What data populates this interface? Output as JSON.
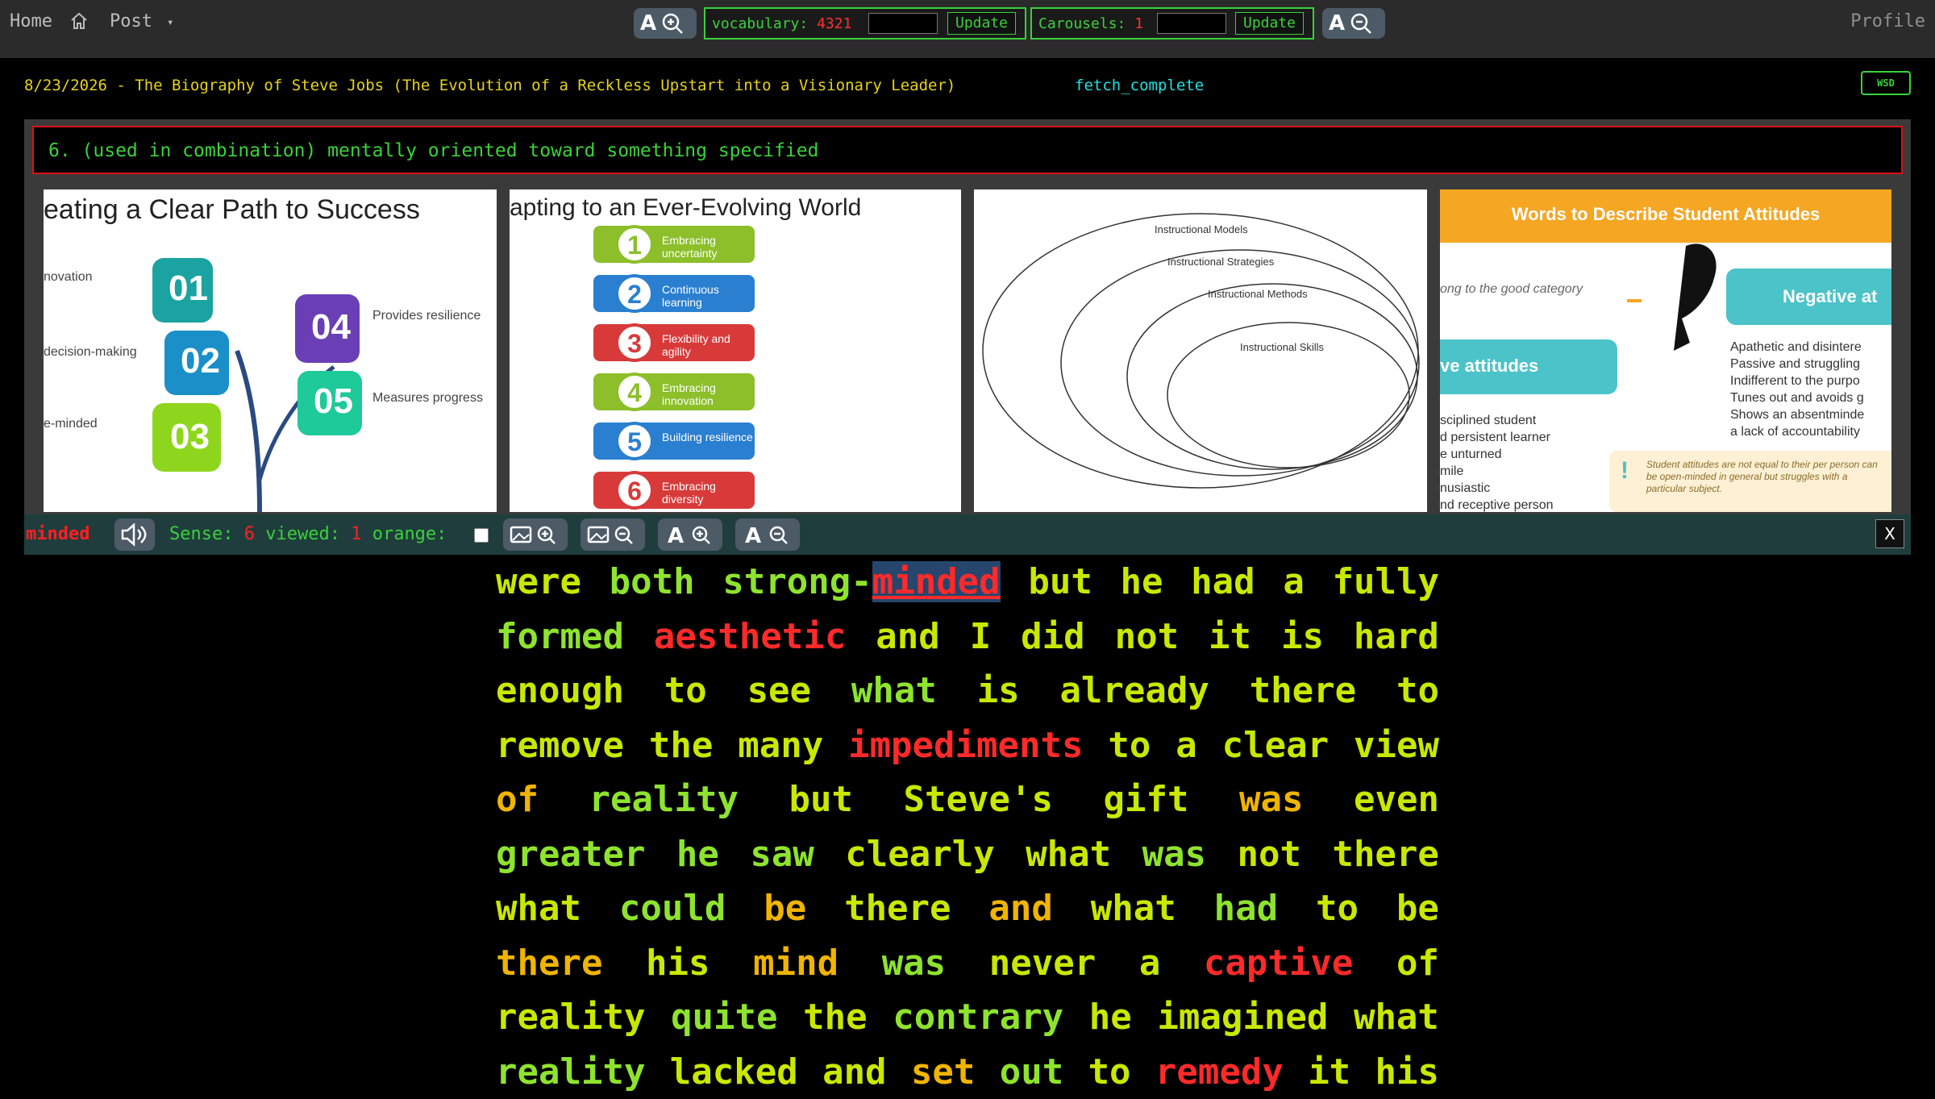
{
  "nav": {
    "home": "Home",
    "post": "Post",
    "caret": "▾",
    "profile": "Profile"
  },
  "stats": {
    "vocab_label": "vocabulary:",
    "vocab_count": "4321",
    "carousel_label": "Carousels:",
    "carousel_count": "1",
    "update": "Update"
  },
  "header": {
    "date": "8/23/2026",
    "title": "8/23/2026 - The Biography of Steve Jobs (The Evolution of a Reckless Upstart into a Visionary Leader)",
    "status": "fetch_complete",
    "wsd": "WSD"
  },
  "definition": "6. (used in combination) mentally oriented toward something specified",
  "thumbs": {
    "t1": {
      "title": "eating a Clear Path to Success",
      "labels": [
        "novation",
        "decision-making",
        "e-minded",
        "Provides resilience",
        "Measures progress"
      ],
      "nums": [
        "01",
        "02",
        "03",
        "04",
        "05"
      ]
    },
    "t2": {
      "title": "apting to an Ever-Evolving World",
      "items": [
        "Embracing uncertainty",
        "Continuous learning",
        "Flexibility and agility",
        "Embracing innovation",
        "Building resilience",
        "Embracing diversity"
      ]
    },
    "t3": {
      "rings": [
        "Instructional Models",
        "Instructional Strategies",
        "Instructional Methods",
        "Instructional Skills"
      ]
    },
    "t4": {
      "banner": "Words to Describe Student Attitudes",
      "neg": "Negative at",
      "pos": "ve attitudes",
      "hint": "ong to the good category",
      "neg_items": [
        "Apathetic and disintere",
        "Passive and struggling",
        "Indifferent to the purpo",
        "Tunes out and avoids g",
        "Shows an absentminde",
        "a lack of accountability"
      ],
      "pos_items": [
        "sciplined student",
        "d persistent learner",
        "e unturned",
        "mile",
        "nusiastic",
        "nd receptive person"
      ],
      "note": "Student attitudes are not equal to their per person can be open-minded in general but struggles with a particular subject."
    }
  },
  "controls": {
    "word": "minded",
    "sense_label": "Sense:",
    "sense": "6",
    "viewed_label": "viewed:",
    "viewed": "1",
    "orange_label": "orange:",
    "close": "X"
  },
  "reading": [
    [
      [
        "were",
        "y"
      ],
      [
        "both",
        "g"
      ],
      [
        "strong-",
        "g"
      ],
      [
        "minded",
        "hl"
      ],
      [
        "but",
        "y"
      ],
      [
        "he",
        "y"
      ],
      [
        "had",
        "y"
      ],
      [
        "a",
        "y"
      ],
      [
        "fully",
        "y"
      ]
    ],
    [
      [
        "formed",
        "g"
      ],
      [
        "aesthetic",
        "r"
      ],
      [
        "and",
        "y"
      ],
      [
        "I",
        "y"
      ],
      [
        "did",
        "y"
      ],
      [
        "not",
        "y"
      ],
      [
        "it",
        "y"
      ],
      [
        "is",
        "y"
      ],
      [
        "hard",
        "y"
      ]
    ],
    [
      [
        "enough",
        "y"
      ],
      [
        "to",
        "y"
      ],
      [
        "see",
        "y"
      ],
      [
        "what",
        "g"
      ],
      [
        "is",
        "y"
      ],
      [
        "already",
        "y"
      ],
      [
        "there",
        "y"
      ],
      [
        "to",
        "y"
      ]
    ],
    [
      [
        "remove",
        "y"
      ],
      [
        "the",
        "y"
      ],
      [
        "many",
        "y"
      ],
      [
        "impediments",
        "r"
      ],
      [
        "to",
        "y"
      ],
      [
        "a",
        "y"
      ],
      [
        "clear",
        "y"
      ],
      [
        "view",
        "y"
      ]
    ],
    [
      [
        "of",
        "o"
      ],
      [
        "reality",
        "g"
      ],
      [
        "but",
        "y"
      ],
      [
        "Steve's",
        "y"
      ],
      [
        "gift",
        "y"
      ],
      [
        "was",
        "o"
      ],
      [
        "even",
        "y"
      ]
    ],
    [
      [
        "greater",
        "g"
      ],
      [
        "he",
        "g"
      ],
      [
        "saw",
        "g"
      ],
      [
        "clearly",
        "y"
      ],
      [
        "what",
        "y"
      ],
      [
        "was",
        "g"
      ],
      [
        "not",
        "y"
      ],
      [
        "there",
        "y"
      ]
    ],
    [
      [
        "what",
        "y"
      ],
      [
        "could",
        "g"
      ],
      [
        "be",
        "o"
      ],
      [
        "there",
        "y"
      ],
      [
        "and",
        "o"
      ],
      [
        "what",
        "y"
      ],
      [
        "had",
        "g"
      ],
      [
        "to",
        "y"
      ],
      [
        "be",
        "y"
      ]
    ],
    [
      [
        "there",
        "o"
      ],
      [
        "his",
        "y"
      ],
      [
        "mind",
        "o"
      ],
      [
        "was",
        "g"
      ],
      [
        "never",
        "y"
      ],
      [
        "a",
        "y"
      ],
      [
        "captive",
        "r"
      ],
      [
        "of",
        "y"
      ]
    ],
    [
      [
        "reality",
        "y"
      ],
      [
        "quite",
        "g"
      ],
      [
        "the",
        "y"
      ],
      [
        "contrary",
        "g"
      ],
      [
        "he",
        "y"
      ],
      [
        "imagined",
        "y"
      ],
      [
        "what",
        "y"
      ]
    ],
    [
      [
        "reality",
        "g"
      ],
      [
        "lacked",
        "y"
      ],
      [
        "and",
        "y"
      ],
      [
        "set",
        "o"
      ],
      [
        "out",
        "g"
      ],
      [
        "to",
        "y"
      ],
      [
        "remedy",
        "r"
      ],
      [
        "it",
        "y"
      ],
      [
        "his",
        "y"
      ]
    ]
  ]
}
